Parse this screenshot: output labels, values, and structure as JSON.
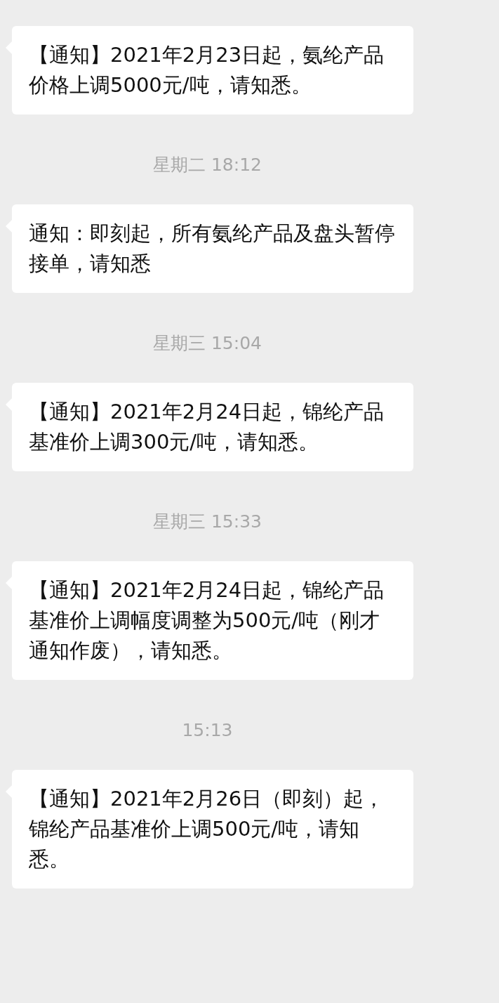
{
  "chat": [
    {
      "kind": "message",
      "text": "【通知】2021年2月23日起，氨纶产品价格上调5000元/吨，请知悉。"
    },
    {
      "kind": "timestamp",
      "text": "星期二 18:12"
    },
    {
      "kind": "message",
      "text": "通知：即刻起，所有氨纶产品及盘头暂停接单，请知悉"
    },
    {
      "kind": "timestamp",
      "text": "星期三 15:04"
    },
    {
      "kind": "message",
      "text": "【通知】2021年2月24日起，锦纶产品基准价上调300元/吨，请知悉。"
    },
    {
      "kind": "timestamp",
      "text": "星期三 15:33"
    },
    {
      "kind": "message",
      "text": "【通知】2021年2月24日起，锦纶产品基准价上调幅度调整为500元/吨（刚才通知作废），请知悉。"
    },
    {
      "kind": "timestamp",
      "text": "15:13"
    },
    {
      "kind": "message",
      "text": "【通知】2021年2月26日（即刻）起，锦纶产品基准价上调500元/吨，请知悉。"
    }
  ]
}
